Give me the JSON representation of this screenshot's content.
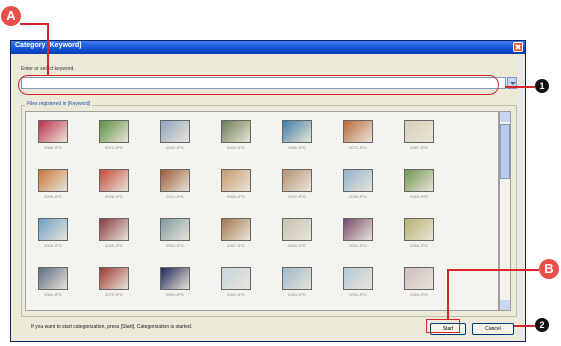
{
  "dialog": {
    "title": "Category [Keyword]",
    "prompt": "Enter or select keyword.",
    "keyword_value": "",
    "group_label": "Files registered in [Keyword]",
    "hint": "If you want to start categorization, press [Start]. Categorization is started.",
    "start_label": "Start",
    "cancel_label": "Cancel"
  },
  "thumbnails": [
    {
      "file": "0085.JPG",
      "color": "#c0304a"
    },
    {
      "file": "0071.JPG",
      "color": "#5a9040"
    },
    {
      "file": "0092.JPG",
      "color": "#8fa6bf"
    },
    {
      "file": "0043.JPG",
      "color": "#6a7e52"
    },
    {
      "file": "0086.JPG",
      "color": "#3e7ea8"
    },
    {
      "file": "0073.JPG",
      "color": "#b96a3c"
    },
    {
      "file": "0087.JPG",
      "color": "#d8d0b8"
    },
    {
      "file": "0090.JPG",
      "color": "#c8783a"
    },
    {
      "file": "0028.JPG",
      "color": "#c44a3a"
    },
    {
      "file": "0110.JPG",
      "color": "#9a5a36"
    },
    {
      "file": "0066.JPG",
      "color": "#c89a6c"
    },
    {
      "file": "0037.JPG",
      "color": "#b59070"
    },
    {
      "file": "0035.JPG",
      "color": "#8fb2cf"
    },
    {
      "file": "0083.JPG",
      "color": "#6f9850"
    },
    {
      "file": "0006.JPG",
      "color": "#6aa0c8"
    },
    {
      "file": "0045.JPG",
      "color": "#8a3a40"
    },
    {
      "file": "0054.JPG",
      "color": "#7e9aa0"
    },
    {
      "file": "0067.JPG",
      "color": "#a67850"
    },
    {
      "file": "0089.JPG",
      "color": "#c8c2b0"
    },
    {
      "file": "0002.JPG",
      "color": "#7a4a6e"
    },
    {
      "file": "0068.JPG",
      "color": "#b7b070"
    },
    {
      "file": "0064.JPG",
      "color": "#5a6c88"
    },
    {
      "file": "0079.JPG",
      "color": "#a03a30"
    },
    {
      "file": "0054.JPG",
      "color": "#1c2a58"
    },
    {
      "file": "0060.JPG",
      "color": "#c4d6e2"
    },
    {
      "file": "0064.JPG",
      "color": "#9cbad0"
    },
    {
      "file": "0094.JPG",
      "color": "#b4cad8"
    },
    {
      "file": "0069.JPG",
      "color": "#d0bcc0"
    }
  ],
  "annotations": {
    "a": "A",
    "b": "B",
    "n1": "1",
    "n2": "2"
  }
}
